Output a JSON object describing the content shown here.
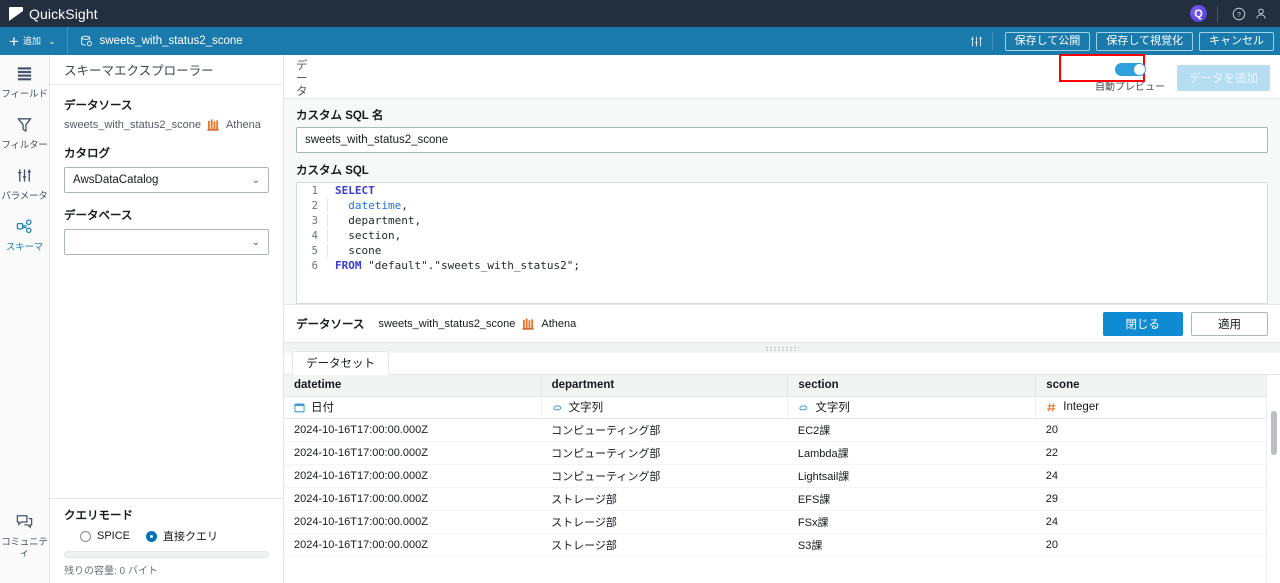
{
  "topbar": {
    "brand": "QuickSight",
    "q_icon": "amazon-q-icon",
    "help_icon": "help-circle-icon",
    "account_icon": "user-icon"
  },
  "actionbar": {
    "add_label": "追加",
    "add_plus": "+",
    "caret": "⌄",
    "dataset_name": "sweets_with_status2_scone",
    "settings_icon": "sliders-icon",
    "buttons": [
      {
        "label": "保存して公開",
        "highlighted": true
      },
      {
        "label": "保存して視覚化",
        "highlighted": false
      },
      {
        "label": "キャンセル",
        "highlighted": false
      }
    ]
  },
  "rail": {
    "items": [
      {
        "label": "フィールド",
        "icon": "fields-icon",
        "active": false
      },
      {
        "label": "フィルター",
        "icon": "filter-icon",
        "active": false
      },
      {
        "label": "パラメータ",
        "icon": "parameters-icon",
        "active": false
      },
      {
        "label": "スキーマ",
        "icon": "schema-icon",
        "active": true
      }
    ],
    "bottom": {
      "label": "コミュニティ",
      "icon": "community-chat-icon"
    }
  },
  "explorer": {
    "title": "スキーマエクスプローラー",
    "datasource_label": "データソース",
    "datasource_value": "sweets_with_status2_scone",
    "datasource_engine": "Athena",
    "catalog_label": "カタログ",
    "catalog_value": "AwsDataCatalog",
    "database_label": "データベース",
    "database_value": ""
  },
  "query_mode": {
    "title": "クエリモード",
    "options": [
      {
        "label": "SPICE",
        "selected": false
      },
      {
        "label": "直接クエリ",
        "selected": true
      }
    ],
    "capacity_text": "残りの容量: 0 バイト"
  },
  "data_panel": {
    "tab_label": "データ",
    "auto_preview_label": "自動プレビュー",
    "auto_preview_on": true,
    "add_data_button": "データを追加"
  },
  "sql": {
    "name_label": "カスタム SQL 名",
    "name_value": "sweets_with_status2_scone",
    "sql_label": "カスタム SQL",
    "lines": [
      {
        "n": "1",
        "indented": false,
        "parts": [
          {
            "t": "SELECT",
            "c": "kw"
          }
        ]
      },
      {
        "n": "2",
        "indented": true,
        "parts": [
          {
            "t": "  ",
            "c": ""
          },
          {
            "t": "datetime",
            "c": "fld"
          },
          {
            "t": ",",
            "c": ""
          }
        ]
      },
      {
        "n": "3",
        "indented": true,
        "parts": [
          {
            "t": "  department,",
            "c": ""
          }
        ]
      },
      {
        "n": "4",
        "indented": true,
        "parts": [
          {
            "t": "  section,",
            "c": ""
          }
        ]
      },
      {
        "n": "5",
        "indented": true,
        "parts": [
          {
            "t": "  scone",
            "c": ""
          }
        ]
      },
      {
        "n": "6",
        "indented": false,
        "parts": [
          {
            "t": "FROM",
            "c": "kw"
          },
          {
            "t": " \"default\".\"sweets_with_status2\";",
            "c": ""
          }
        ]
      }
    ]
  },
  "ds_footer": {
    "label": "データソース",
    "name": "sweets_with_status2_scone",
    "engine": "Athena",
    "close_button": "閉じる",
    "apply_button": "適用"
  },
  "preview": {
    "tab_label": "データセット",
    "columns": [
      {
        "name": "datetime",
        "type_label": "日付",
        "type_icon": "calendar-icon"
      },
      {
        "name": "department",
        "type_label": "文字列",
        "type_icon": "string-icon"
      },
      {
        "name": "section",
        "type_label": "文字列",
        "type_icon": "string-icon"
      },
      {
        "name": "scone",
        "type_label": "Integer",
        "type_icon": "number-icon"
      }
    ],
    "rows": [
      [
        "2024-10-16T17:00:00.000Z",
        "コンピューティング部",
        "EC2課",
        "20"
      ],
      [
        "2024-10-16T17:00:00.000Z",
        "コンピューティング部",
        "Lambda課",
        "22"
      ],
      [
        "2024-10-16T17:00:00.000Z",
        "コンピューティング部",
        "Lightsail課",
        "24"
      ],
      [
        "2024-10-16T17:00:00.000Z",
        "ストレージ部",
        "EFS課",
        "29"
      ],
      [
        "2024-10-16T17:00:00.000Z",
        "ストレージ部",
        "FSx課",
        "24"
      ],
      [
        "2024-10-16T17:00:00.000Z",
        "ストレージ部",
        "S3課",
        "20"
      ]
    ]
  },
  "colors": {
    "nav_dark": "#232f3e",
    "action_blue": "#1a7aab",
    "accent": "#0073bb",
    "highlight_red": "#ff0000"
  }
}
